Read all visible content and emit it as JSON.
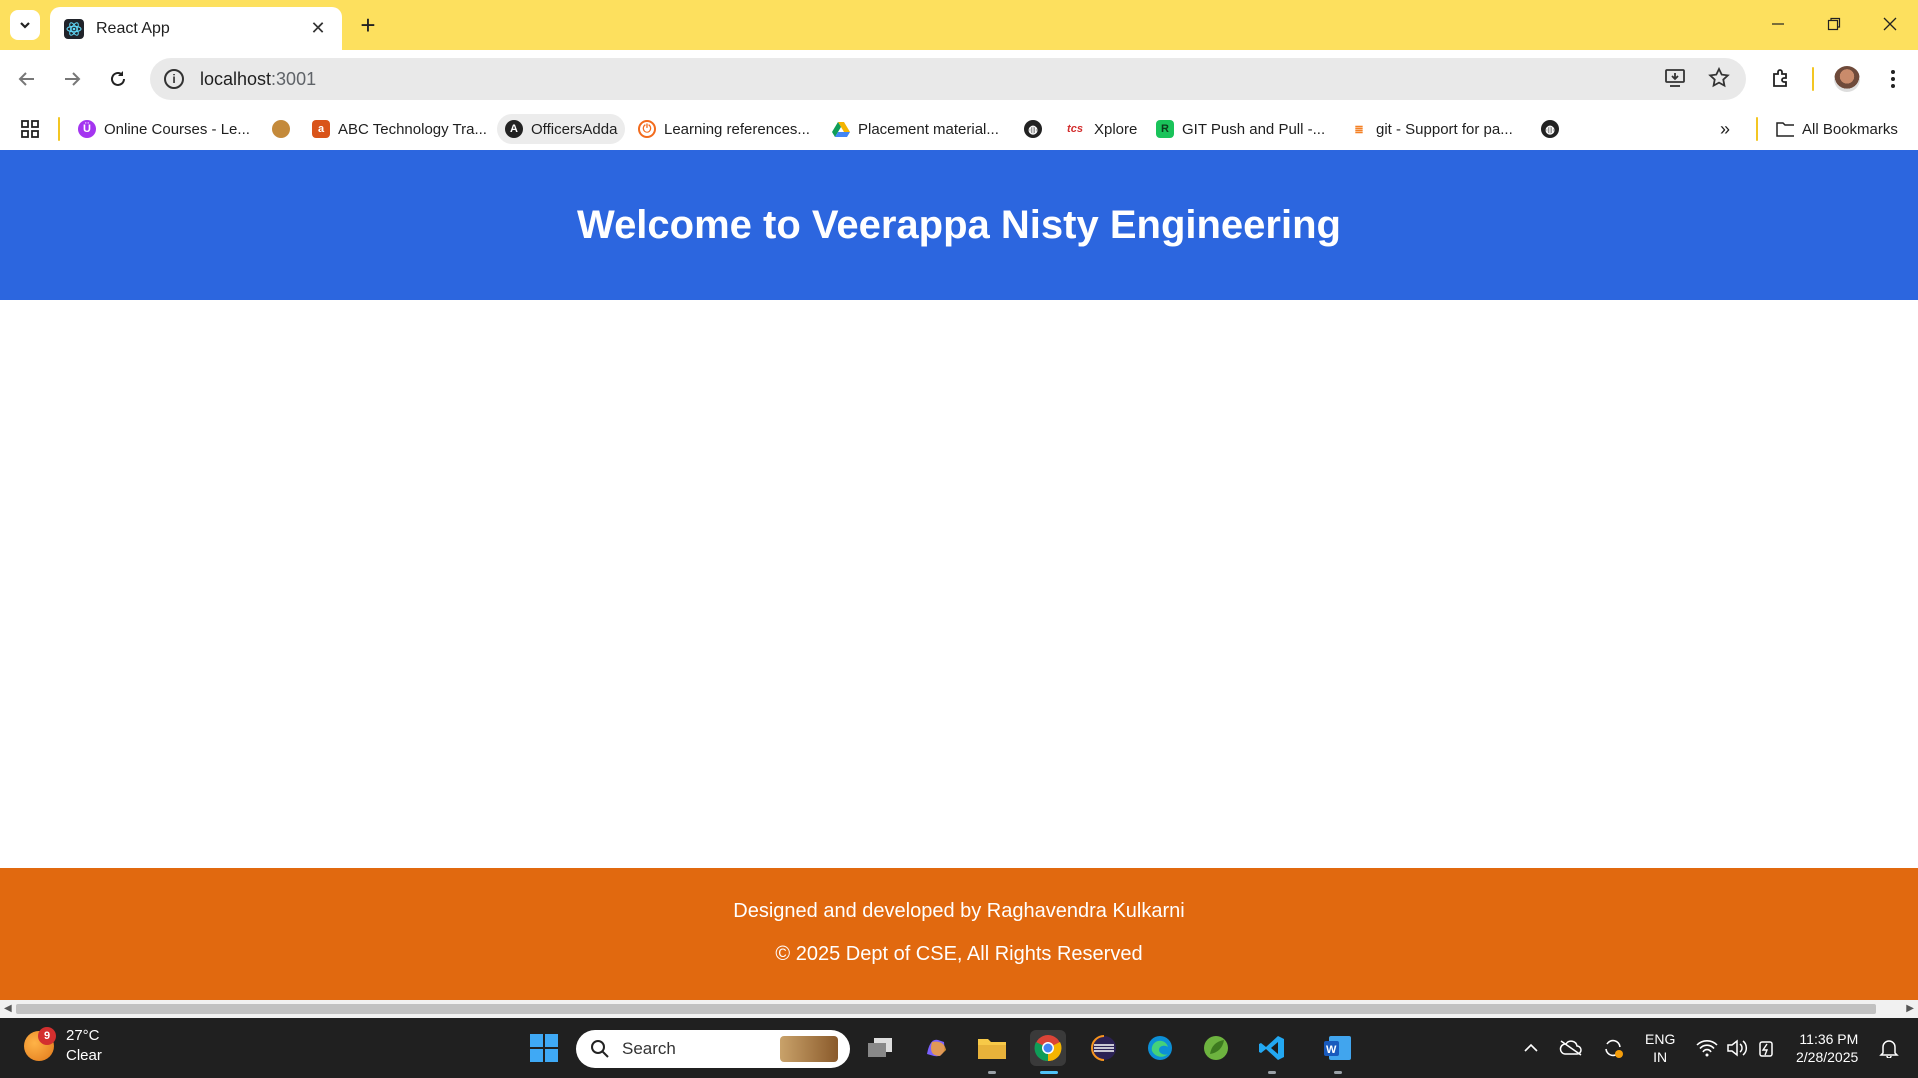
{
  "browser": {
    "tab": {
      "title": "React App"
    },
    "omnibox": {
      "host": "localhost",
      "port": ":3001"
    },
    "bookmarks": [
      {
        "label": "Online Courses - Le...",
        "icon": "udemy-icon",
        "color": "#a435f0"
      },
      {
        "label": "",
        "icon": "emblem-icon",
        "color": "#b5651d"
      },
      {
        "label": "ABC Technology Tra...",
        "icon": "abc-icon",
        "color": "#d9541a"
      },
      {
        "label": "OfficersAdda",
        "icon": "officersadda-icon",
        "color": "#222222"
      },
      {
        "label": "Learning references...",
        "icon": "power-icon",
        "color": "#f26b1d"
      },
      {
        "label": "Placement material...",
        "icon": "google-drive-icon",
        "color": "#0f9d58"
      },
      {
        "label": "",
        "icon": "globe-icon",
        "color": "#222222"
      },
      {
        "label": "Xplore",
        "icon": "tcs-icon",
        "color": "#d32f2f"
      },
      {
        "label": "GIT Push and Pull -...",
        "icon": "git-icon",
        "color": "#19c35a"
      },
      {
        "label": "git - Support for pa...",
        "icon": "stackoverflow-icon",
        "color": "#f48024"
      },
      {
        "label": "",
        "icon": "globe-icon",
        "color": "#222222"
      }
    ],
    "all_bookmarks": "All Bookmarks"
  },
  "page": {
    "header_title": "Welcome to Veerappa Nisty Engineering",
    "footer_line1": "Designed and developed by Raghavendra Kulkarni",
    "footer_line2": "© 2025 Dept of CSE, All Rights Reserved",
    "colors": {
      "header": "#2c66df",
      "footer": "#e1690f"
    }
  },
  "taskbar": {
    "weather": {
      "badge": "9",
      "temp": "27°C",
      "condition": "Clear"
    },
    "search_placeholder": "Search",
    "lang_line1": "ENG",
    "lang_line2": "IN",
    "time": "11:36 PM",
    "date": "2/28/2025"
  }
}
